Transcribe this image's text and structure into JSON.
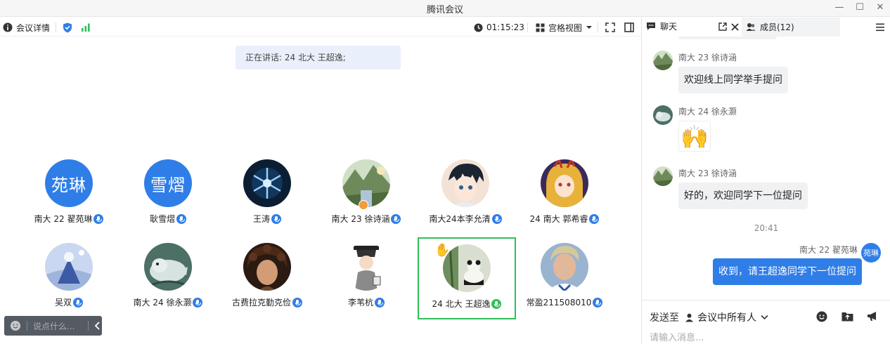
{
  "window": {
    "title": "腾讯会议",
    "controls": [
      "—",
      "☐",
      "✕"
    ]
  },
  "toolbar": {
    "meeting_info_label": "会议详情",
    "timer": "01:15:23",
    "view_label": "宫格视图"
  },
  "main": {
    "speaking_text": "正在讲话: 24 北大 王超逸;",
    "chat_placeholder": "说点什么..."
  },
  "participants": [
    {
      "name": "南大 22 翟苑琳",
      "avatar_text": "苑琳"
    },
    {
      "name": "耿雪熠",
      "avatar_text": "雪熠"
    },
    {
      "name": "王涛",
      "avatar": "snowflake-photo"
    },
    {
      "name": "南大 23 徐诗涵",
      "avatar": "landscape-photo",
      "badge": "host"
    },
    {
      "name": "南大24本李允清",
      "avatar": "anime-boy"
    },
    {
      "name": "24 南大 郭希睿",
      "avatar": "anime-girl"
    },
    {
      "name": "吴双",
      "avatar": "illustration"
    },
    {
      "name": "南大 24 徐永灏",
      "avatar": "seal-cartoon"
    },
    {
      "name": "古费拉克勤克俭",
      "avatar": "curly-hair-portrait"
    },
    {
      "name": "李苇杭",
      "avatar": "cartoon-figure"
    },
    {
      "name": "24 北大 王超逸",
      "avatar": "panda-painting",
      "active": true,
      "raised_hand": true
    },
    {
      "name": "常盈211508010",
      "avatar": "photo-portrait"
    }
  ],
  "panel": {
    "chat_tab_label": "聊天",
    "members_tab_label": "成员(12)",
    "messages": [
      {
        "sender": "南大 23 徐诗涵",
        "text": "欢迎线上同学举手提问"
      },
      {
        "sender": "南大 24 徐永灏",
        "text": "🙌"
      },
      {
        "sender": "南大 23 徐诗涵",
        "text": "好的，欢迎同学下一位提问"
      }
    ],
    "timestamp": "20:41",
    "my_message": {
      "sender": "南大 22 翟苑琳",
      "avatar_text": "苑琳",
      "text": "收到，请王超逸同学下一位提问"
    },
    "send_to_label": "发送至",
    "recipient_label": "会议中所有人",
    "input_placeholder": "请输入消息..."
  },
  "colors": {
    "accent": "#2f7ee8",
    "active_border": "#2fbf5a",
    "host_badge": "#f29b38"
  }
}
